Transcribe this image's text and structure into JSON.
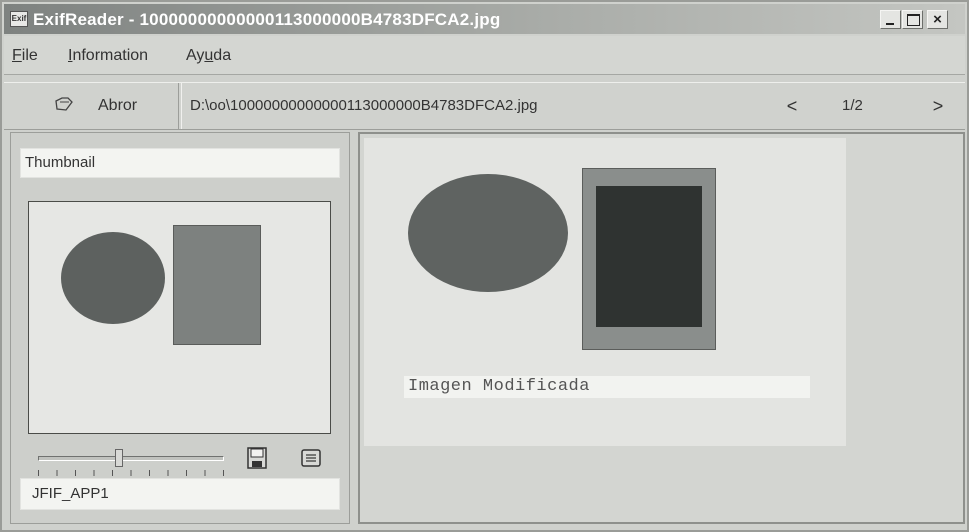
{
  "window": {
    "title": "ExifReader - 10000000000000113000000B4783DFCA2.jpg",
    "app_icon_label": "Exif",
    "controls": {
      "minimize": "minimize",
      "maximize": "maximize",
      "close": "×"
    }
  },
  "menu": {
    "file": {
      "accel": "F",
      "rest": "ile"
    },
    "information": {
      "accel": "I",
      "rest": "nformation"
    },
    "ayuda": {
      "pre": "Ay",
      "accel": "u",
      "rest": "da"
    }
  },
  "toolbar": {
    "open_label": "Abror",
    "open_icon": "open-folder-icon",
    "path": "D:\\oo\\10000000000000113000000B4783DFCA2.jpg",
    "prev": "<",
    "next": ">",
    "page": "1/2"
  },
  "left_panel": {
    "thumbnail_label": "Thumbnail",
    "segment_label": "JFIF_APP1",
    "slider_level": 0.43,
    "save_icon": "save-icon",
    "list_icon": "list-icon"
  },
  "image_panel": {
    "caption": "Imagen Modificada"
  }
}
